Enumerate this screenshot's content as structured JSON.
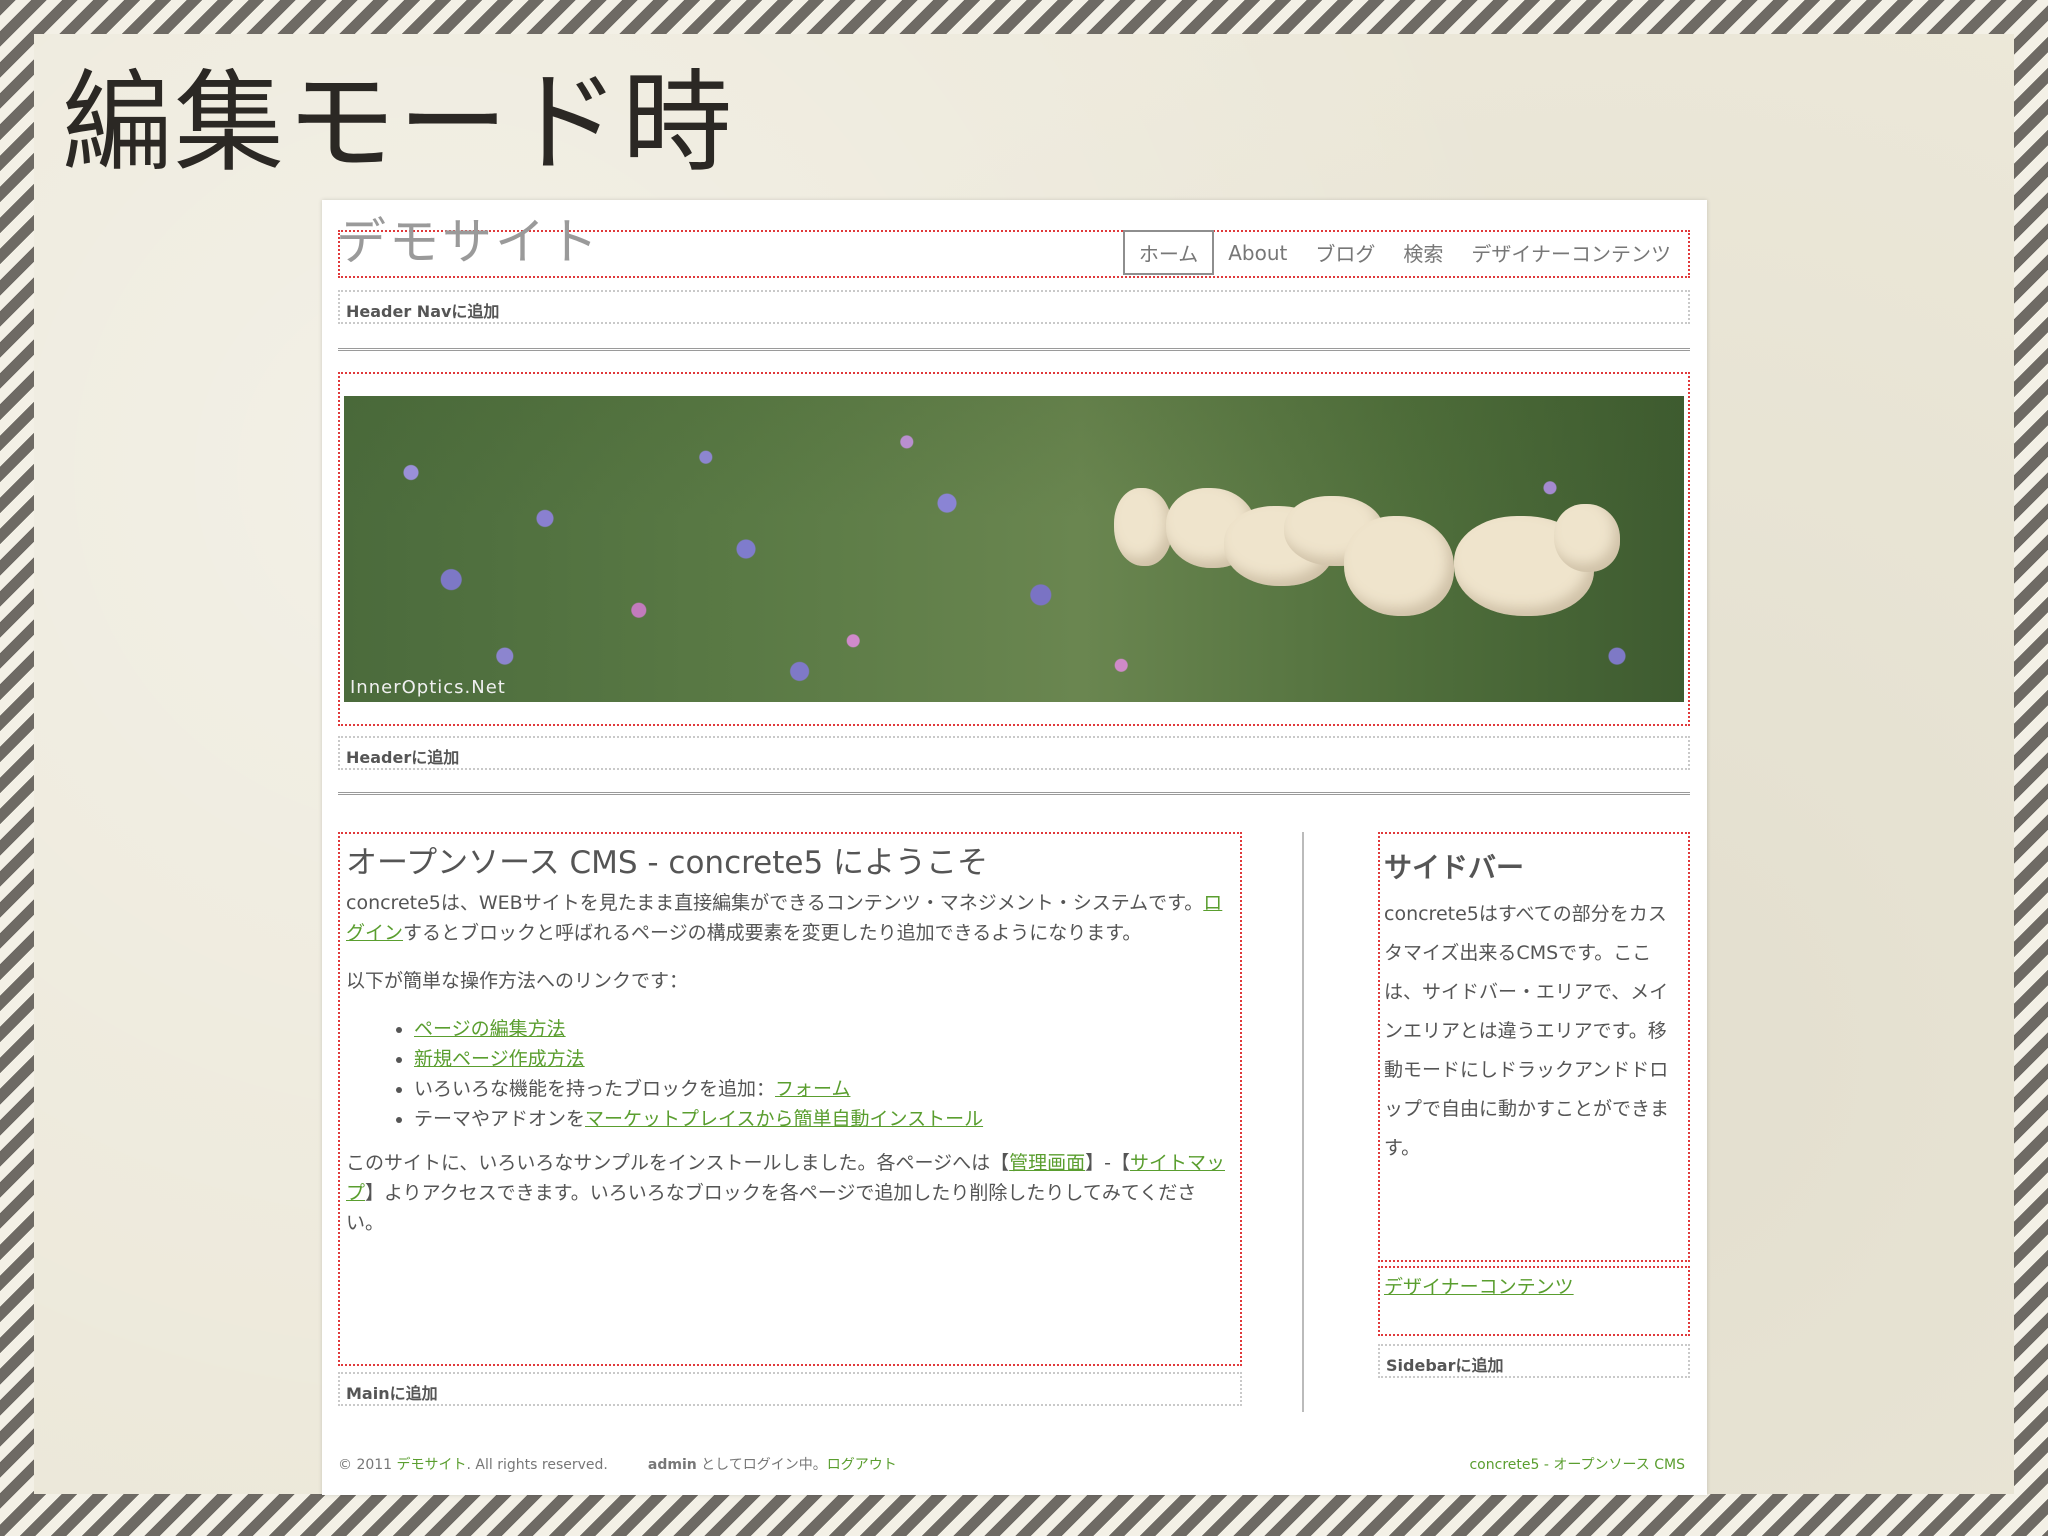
{
  "slide": {
    "title": "編集モード時"
  },
  "site": {
    "title": "デモサイト",
    "nav": [
      "ホーム",
      "About",
      "ブログ",
      "検索",
      "デザイナーコンテンツ"
    ],
    "header_nav_add": "Header Navに追加",
    "hero_credit": "InnerOptics.Net",
    "header_add": "Headerに追加"
  },
  "main": {
    "heading": "オープンソース CMS - concrete5 にようこそ",
    "intro_1": "concrete5は、WEBサイトを見たまま直接編集ができるコンテンツ・マネジメント・システムです。",
    "login_link": "ログイン",
    "intro_2": "するとブロックと呼ばれるページの構成要素を変更したり追加できるようになります。",
    "links_intro": "以下が簡単な操作方法へのリンクです：",
    "list": [
      {
        "pre": "",
        "link": "ページの編集方法"
      },
      {
        "pre": "",
        "link": "新規ページ作成方法"
      },
      {
        "pre": "いろいろな機能を持ったブロックを追加：",
        "link": "フォーム"
      },
      {
        "pre": "テーマやアドオンを",
        "link": "マーケットプレイスから簡単自動インストール"
      }
    ],
    "outro_1": "このサイトに、いろいろなサンプルをインストールしました。各ページへは【",
    "admin_link": "管理画面",
    "outro_2": "】-【",
    "sitemap_link": "サイトマップ",
    "outro_3": "】よりアクセスできます。いろいろなブロックを各ページで追加したり削除したりしてみてください。",
    "add": "Mainに追加"
  },
  "sidebar": {
    "heading": "サイドバー",
    "body": "concrete5はすべての部分をカスタマイズ出来るCMSです。ここは、サイドバー・エリアで、メインエリアとは違うエリアです。移動モードにしドラックアンドドロップで自由に動かすことができます。",
    "designer_link": "デザイナーコンテンツ",
    "add": "Sidebarに追加"
  },
  "footer": {
    "copyright_pre": "© 2011 ",
    "site_link": "デモサイト",
    "copyright_post": ". All rights reserved.",
    "user": "admin",
    "logged_in": " としてログイン中。",
    "logout": "ログアウト",
    "powered": "concrete5 - オープンソース CMS"
  },
  "colors": {
    "link": "#5a9e2f",
    "edit_area": "#e0393b",
    "add_area": "#c9c9c9"
  }
}
